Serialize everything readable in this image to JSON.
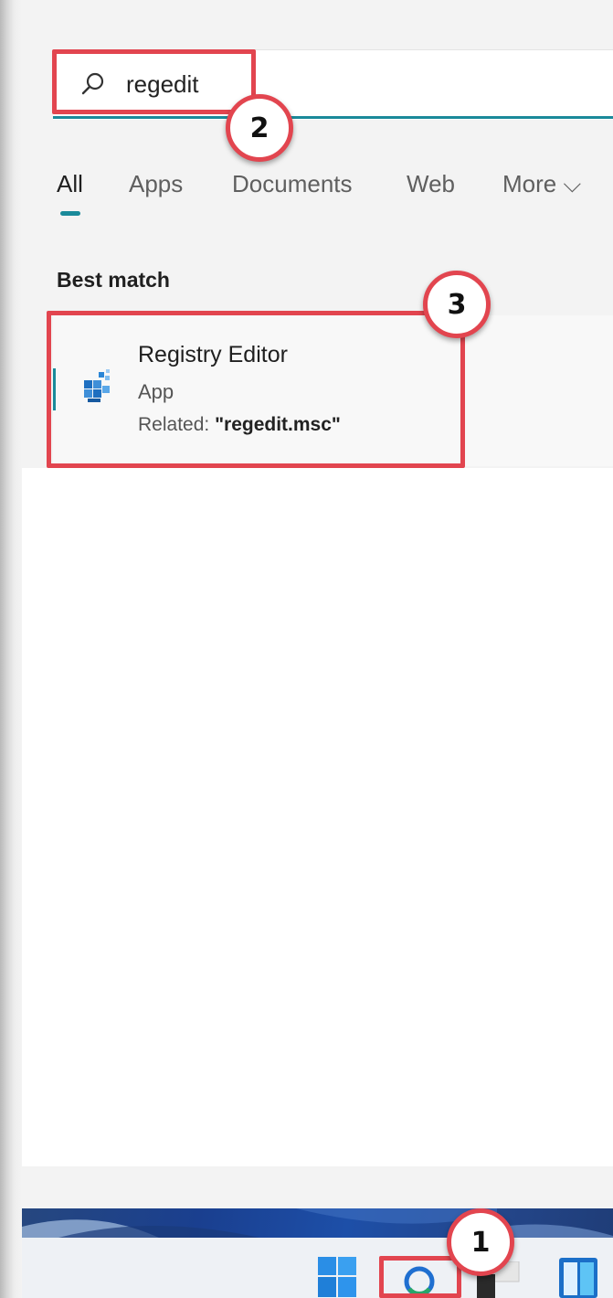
{
  "search": {
    "query": "regedit"
  },
  "tabs": [
    {
      "label": "All",
      "active": true
    },
    {
      "label": "Apps"
    },
    {
      "label": "Documents"
    },
    {
      "label": "Web"
    },
    {
      "label": "More ⌵"
    }
  ],
  "best_match": {
    "title": "Best match",
    "result": {
      "name": "Registry Editor",
      "type": "App",
      "related_prefix": "Related: ",
      "related_value": "\"regedit.msc\""
    }
  },
  "annotations": {
    "step1": "1",
    "step2": "2",
    "step3": "3",
    "color": "#e2454f"
  },
  "colors": {
    "accent": "#1a8a9a",
    "panel": "#f3f3f3",
    "taskbar": "#eef1f5"
  },
  "icons": {
    "search": "search-icon",
    "app": "registry-editor-icon",
    "start": "windows-start-icon",
    "taskbar_search": "search-circle-icon",
    "task_view": "task-view-icon",
    "widgets": "widgets-icon"
  }
}
